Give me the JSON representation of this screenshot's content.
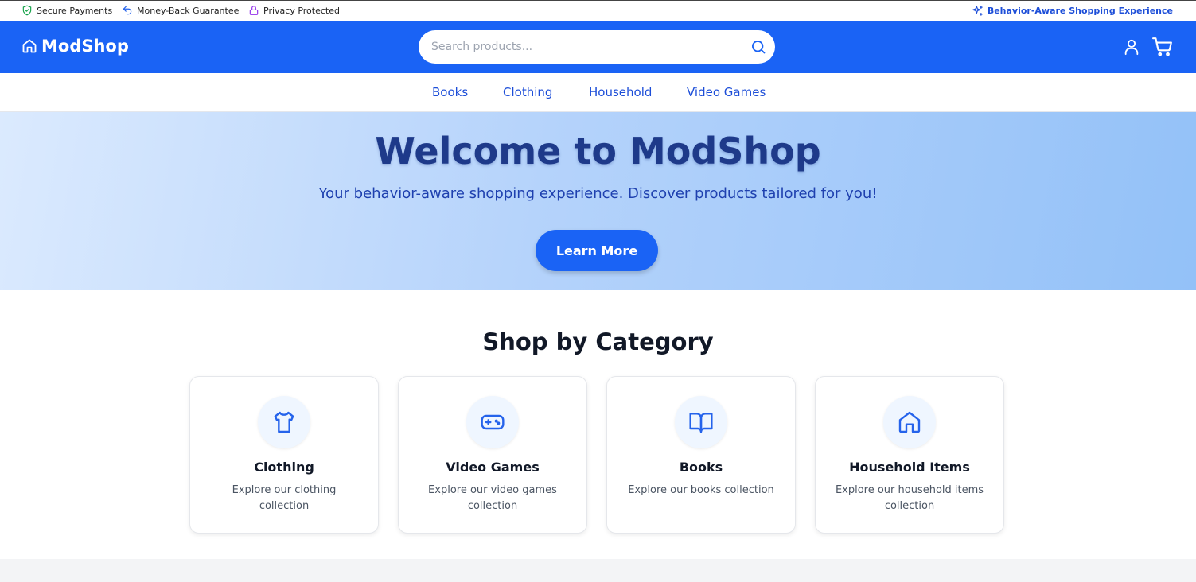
{
  "trust_bar": {
    "items": [
      {
        "label": "Secure Payments",
        "icon": "shield-check-icon",
        "color": "#16a34a"
      },
      {
        "label": "Money-Back Guarantee",
        "icon": "undo-arrow-icon",
        "color": "#2563eb"
      },
      {
        "label": "Privacy Protected",
        "icon": "lock-icon",
        "color": "#9333ea"
      }
    ],
    "right_label": "Behavior-Aware Shopping Experience",
    "right_icon": "sparkles-icon"
  },
  "header": {
    "logo_text": "ModShop",
    "logo_icon": "home-icon",
    "search_placeholder": "Search products...",
    "search_icon": "search-icon",
    "account_icon": "user-icon",
    "cart_icon": "cart-icon",
    "brand_color": "#1a63f5"
  },
  "nav": {
    "items": [
      "Books",
      "Clothing",
      "Household",
      "Video Games"
    ]
  },
  "hero": {
    "title": "Welcome to ModShop",
    "subtitle": "Your behavior-aware shopping experience. Discover products tailored for you!",
    "button_label": "Learn More"
  },
  "categories": {
    "title": "Shop by Category",
    "items": [
      {
        "title": "Clothing",
        "description": "Explore our clothing collection",
        "icon": "shirt-icon"
      },
      {
        "title": "Video Games",
        "description": "Explore our video games collection",
        "icon": "gamepad-icon"
      },
      {
        "title": "Books",
        "description": "Explore our books collection",
        "icon": "book-open-icon"
      },
      {
        "title": "Household Items",
        "description": "Explore our household items collection",
        "icon": "home-icon"
      }
    ]
  }
}
